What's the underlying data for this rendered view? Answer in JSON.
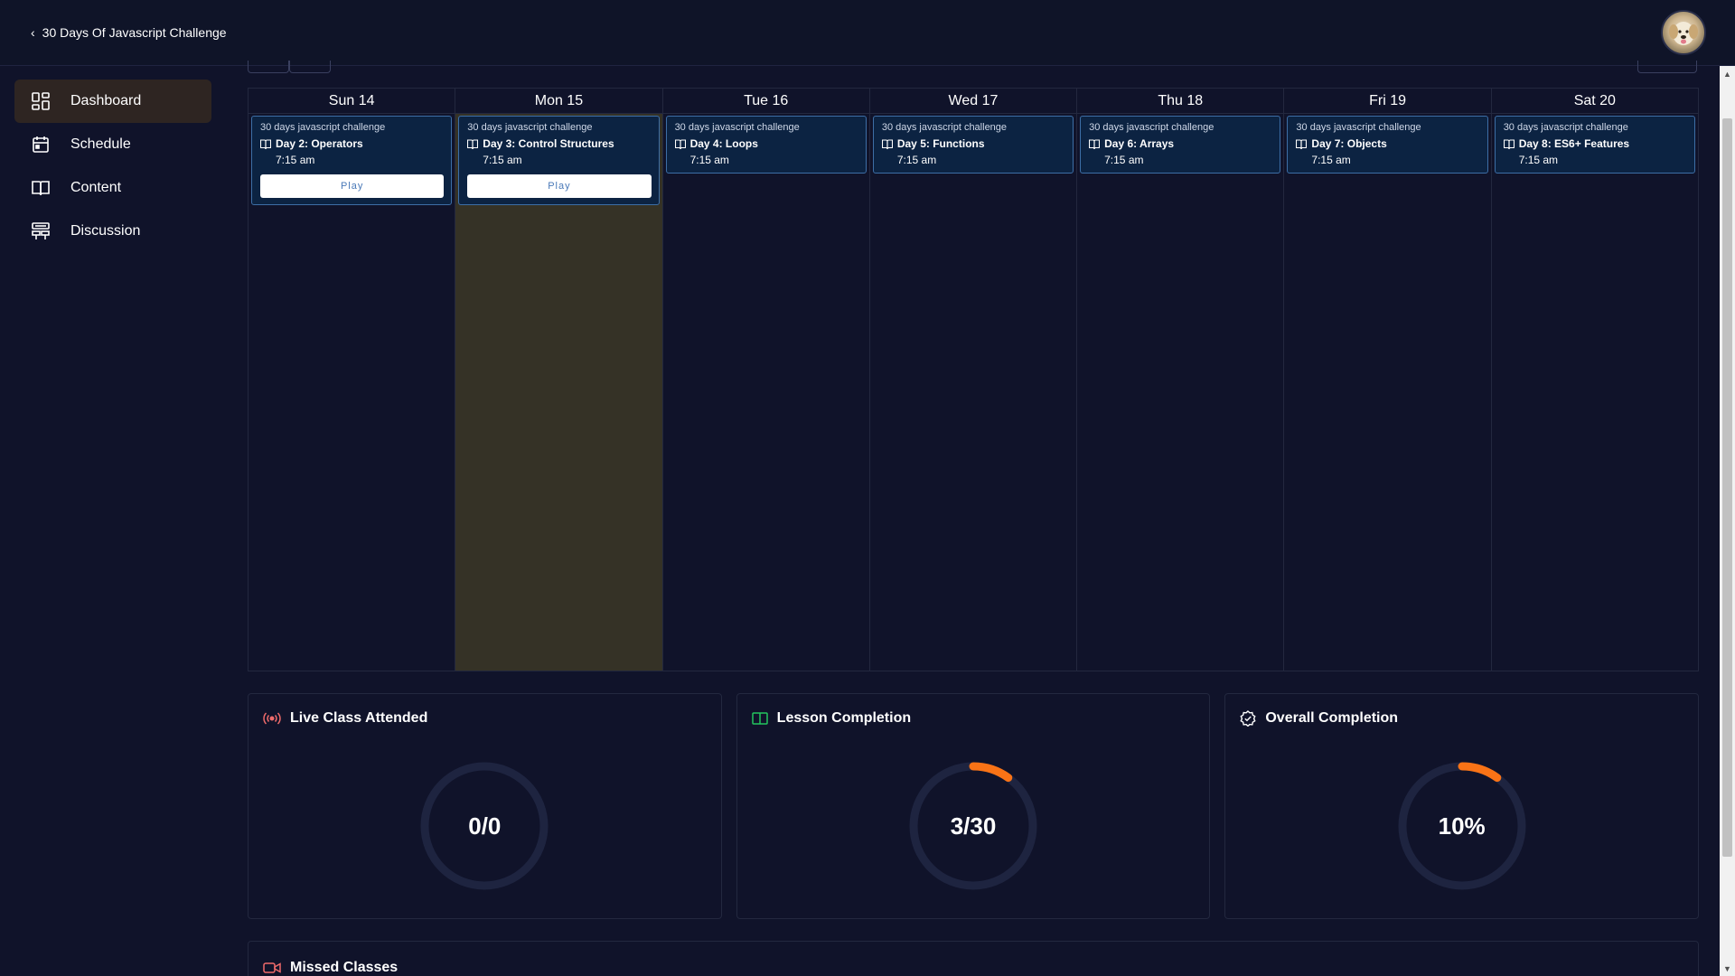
{
  "header": {
    "back_label": "30 Days Of Javascript Challenge",
    "back_icon": "chevron-left-icon",
    "avatar_icon": "user-avatar"
  },
  "sidebar": {
    "items": [
      {
        "label": "Dashboard",
        "icon": "dashboard-icon",
        "active": true
      },
      {
        "label": "Schedule",
        "icon": "calendar-icon",
        "active": false
      },
      {
        "label": "Content",
        "icon": "book-icon",
        "active": false
      },
      {
        "label": "Discussion",
        "icon": "discussion-icon",
        "active": false
      }
    ]
  },
  "calendar": {
    "days": [
      {
        "label": "Sun 14",
        "today": false,
        "event": {
          "course": "30 days javascript challenge",
          "title": "Day 2: Operators",
          "time": "7:15 am",
          "play": "Play"
        }
      },
      {
        "label": "Mon 15",
        "today": true,
        "event": {
          "course": "30 days javascript challenge",
          "title": "Day 3: Control Structures",
          "time": "7:15 am",
          "play": "Play"
        }
      },
      {
        "label": "Tue 16",
        "today": false,
        "event": {
          "course": "30 days javascript challenge",
          "title": "Day 4: Loops",
          "time": "7:15 am",
          "play": ""
        }
      },
      {
        "label": "Wed 17",
        "today": false,
        "event": {
          "course": "30 days javascript challenge",
          "title": "Day 5: Functions",
          "time": "7:15 am",
          "play": ""
        }
      },
      {
        "label": "Thu 18",
        "today": false,
        "event": {
          "course": "30 days javascript challenge",
          "title": "Day 6: Arrays",
          "time": "7:15 am",
          "play": ""
        }
      },
      {
        "label": "Fri 19",
        "today": false,
        "event": {
          "course": "30 days javascript challenge",
          "title": "Day 7: Objects",
          "time": "7:15 am",
          "play": ""
        }
      },
      {
        "label": "Sat 20",
        "today": false,
        "event": {
          "course": "30 days javascript challenge",
          "title": "Day 8: ES6+ Features",
          "time": "7:15 am",
          "play": ""
        }
      }
    ]
  },
  "stats": {
    "live": {
      "title": "Live Class Attended",
      "icon": "broadcast-icon",
      "value": "0/0",
      "progress": 0
    },
    "lesson": {
      "title": "Lesson Completion",
      "icon": "book-open-icon",
      "value": "3/30",
      "progress": 0.1
    },
    "overall": {
      "title": "Overall Completion",
      "icon": "check-badge-icon",
      "value": "10%",
      "progress": 0.1
    }
  },
  "missed": {
    "title": "Missed Classes",
    "icon": "video-icon"
  },
  "colors": {
    "background": "#10132a",
    "accent": "#f97316",
    "event_bg": "#0c2342",
    "event_border": "#3d6ea6",
    "today_bg": "#353226",
    "ring_track": "#1e2440",
    "active_nav": "#2e2522"
  }
}
